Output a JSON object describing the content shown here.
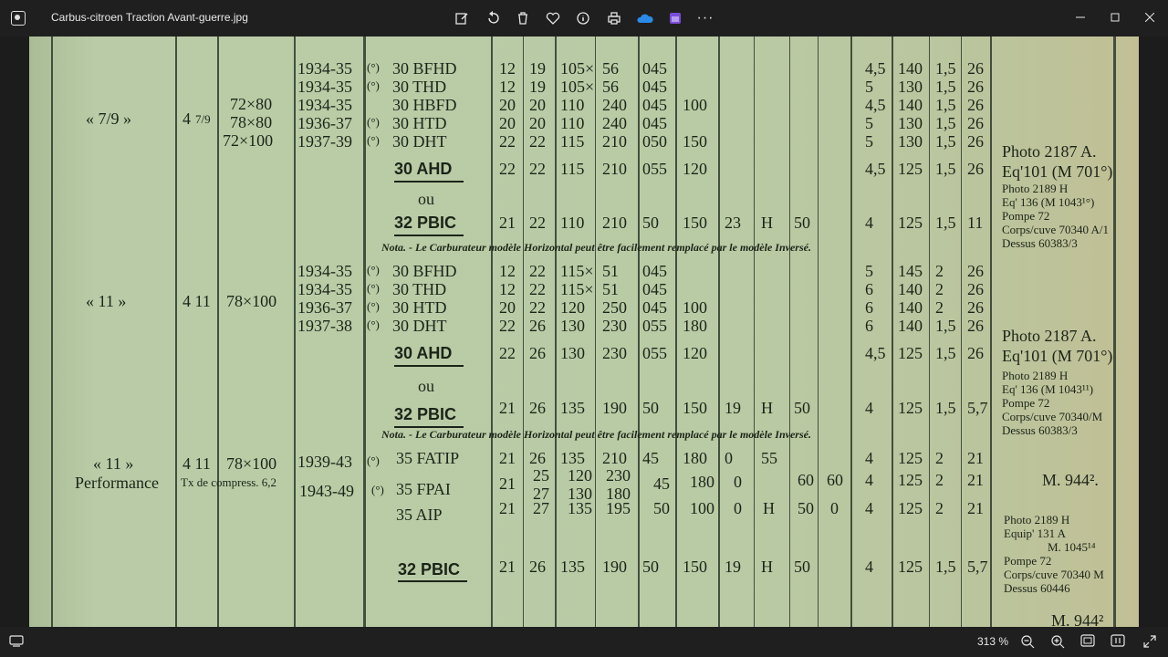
{
  "window": {
    "title": "Carbus-citroen Traction Avant-guerre.jpg",
    "toolbar_icons": [
      "edit-icon",
      "rotate-icon",
      "delete-icon",
      "favorite-icon",
      "info-icon",
      "print-icon",
      "onedrive-icon",
      "clipchamp-icon",
      "more-icon"
    ],
    "more_label": "···"
  },
  "status": {
    "zoom_label": "313 %"
  },
  "doc": {
    "model_79": "« 7/9 »",
    "cyl_79": "4",
    "cyl_79_sub": "7/9",
    "bore_79": [
      "72×80",
      "78×80",
      "72×100"
    ],
    "years_79": [
      "1934-35",
      "1934-35",
      "1934-35",
      "1936-37",
      "1937-39"
    ],
    "marks_79": [
      "(°)",
      "(°)",
      "",
      "(°)",
      "(°)"
    ],
    "carbs_79": [
      "30 BFHD",
      "30 THD",
      "30 HBFD",
      "30 HTD",
      "30 DHT"
    ],
    "rows_79": [
      [
        "12",
        "19",
        "105×",
        "56",
        "045",
        "",
        "",
        "",
        "",
        "4,5",
        "140",
        "1,5",
        "26"
      ],
      [
        "12",
        "19",
        "105×",
        "56",
        "045",
        "",
        "",
        "",
        "",
        "5",
        "130",
        "1,5",
        "26"
      ],
      [
        "20",
        "20",
        "110",
        "240",
        "045",
        "100",
        "",
        "",
        "",
        "4,5",
        "140",
        "1,5",
        "26"
      ],
      [
        "20",
        "20",
        "110",
        "240",
        "045",
        "",
        "",
        "",
        "",
        "5",
        "130",
        "1,5",
        "26"
      ],
      [
        "22",
        "22",
        "115",
        "210",
        "050",
        "150",
        "",
        "",
        "",
        "5",
        "130",
        "1,5",
        "26"
      ]
    ],
    "ahd_79": {
      "label": "30 AHD",
      "vals": [
        "22",
        "22",
        "115",
        "210",
        "055",
        "120",
        "",
        "",
        "",
        "4,5",
        "125",
        "1,5",
        "26"
      ]
    },
    "ou": "ou",
    "pbic_79": {
      "label": "32 PBIC",
      "vals": [
        "21",
        "22",
        "110",
        "210",
        "50",
        "150",
        "23",
        "H",
        "50",
        "4",
        "125",
        "1,5",
        "11"
      ]
    },
    "notes_79": [
      "Photo 2187 A.",
      "Eq'101 (M 701°)"
    ],
    "notes_79b": [
      "Photo 2189 H",
      "Eq' 136 (M 1043¹°)",
      "Pompe 72",
      "Corps/cuve 70340 A/1",
      "Dessus 60383/3"
    ],
    "nota": "Nota. - Le Carburateur modèle Horizontal peut être facilement remplacé par le modèle Inversé.",
    "model_11": "« 11 »",
    "cyl_11": "4 11",
    "bore_11": "78×100",
    "years_11": [
      "1934-35",
      "1934-35",
      "1936-37",
      "1937-38"
    ],
    "marks_11": [
      "(°)",
      "(°)",
      "(°)",
      "(°)"
    ],
    "carbs_11": [
      "30 BFHD",
      "30 THD",
      "30 HTD",
      "30 DHT"
    ],
    "rows_11": [
      [
        "12",
        "22",
        "115×",
        "51",
        "045",
        "",
        "",
        "",
        "",
        "5",
        "145",
        "2",
        "26"
      ],
      [
        "12",
        "22",
        "115×",
        "51",
        "045",
        "",
        "",
        "",
        "",
        "6",
        "140",
        "2",
        "26"
      ],
      [
        "20",
        "22",
        "120",
        "250",
        "045",
        "100",
        "",
        "",
        "",
        "6",
        "140",
        "2",
        "26"
      ],
      [
        "22",
        "26",
        "130",
        "230",
        "055",
        "180",
        "",
        "",
        "",
        "6",
        "140",
        "1,5",
        "26"
      ]
    ],
    "ahd_11": {
      "label": "30 AHD",
      "vals": [
        "22",
        "26",
        "130",
        "230",
        "055",
        "120",
        "",
        "",
        "",
        "4,5",
        "125",
        "1,5",
        "26"
      ]
    },
    "pbic_11": {
      "label": "32 PBIC",
      "vals": [
        "21",
        "26",
        "135",
        "190",
        "50",
        "150",
        "19",
        "H",
        "50",
        "4",
        "125",
        "1,5",
        "5,7"
      ]
    },
    "notes_11": [
      "Photo 2187 A.",
      "Eq'101 (M 701°)"
    ],
    "notes_11b": [
      "Photo 2189 H",
      "Eq' 136 (M 1043¹¹)",
      "Pompe 72",
      "Corps/cuve 70340/M",
      "Dessus 60383/3"
    ],
    "nota2": "Nota. - Le Carburateur modèle Horizontal peut être facilement remplacé par le modèle Inversé.",
    "model_perf": "« 11 »",
    "perf_label": "Performance",
    "cyl_perf": "4 11",
    "bore_perf": "78×100",
    "compress": "Tx de compress. 6,2",
    "years_perf": [
      "1939-43",
      "1943-49"
    ],
    "marks_perf": [
      "(°)",
      "(°)"
    ],
    "carbs_perf": [
      "35 FATIP",
      "35 FPAI",
      "35 AIP"
    ],
    "row_fatip": [
      "21",
      "26",
      "135",
      "210",
      "45",
      "180",
      "0",
      "55",
      "",
      "4",
      "125",
      "2",
      "21"
    ],
    "row_fpai": [
      "21",
      "25",
      "27",
      "120",
      "130",
      "230",
      "180",
      "45",
      "180",
      "0",
      "60",
      "60",
      "4",
      "125",
      "2",
      "21"
    ],
    "row_aip": [
      "21",
      "27",
      "135",
      "195",
      "50",
      "100",
      "0",
      "H",
      "50",
      "0",
      "4",
      "125",
      "2",
      "21"
    ],
    "m944": "M. 944².",
    "pbic_perf": {
      "label": "32 PBIC",
      "vals": [
        "21",
        "26",
        "135",
        "190",
        "50",
        "150",
        "19",
        "H",
        "50",
        "4",
        "125",
        "1,5",
        "5,7"
      ]
    },
    "notes_perf": [
      "Photo 2189 H",
      "Equip' 131 A",
      "M. 1045¹⁴",
      "Pompe 72",
      "Corps/cuve 70340 M",
      "Dessus 60446"
    ],
    "m944b": "M. 944²"
  }
}
